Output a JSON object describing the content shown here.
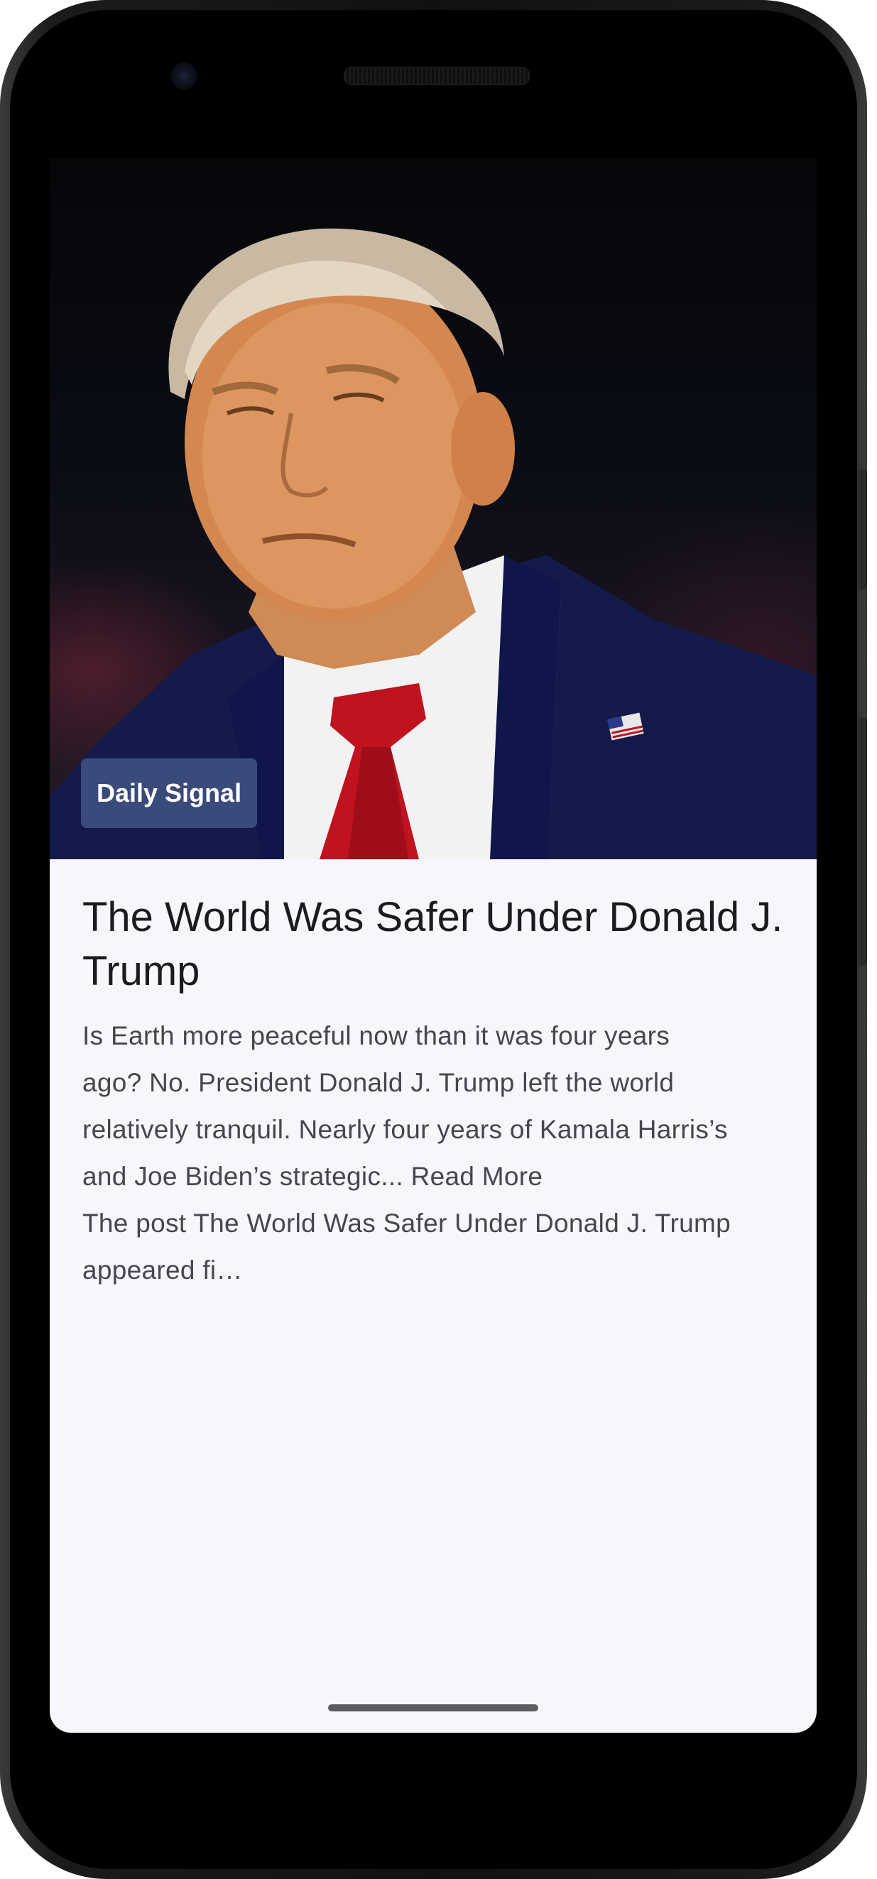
{
  "article": {
    "source": "Daily Signal",
    "title": "The World Was Safer Under Donald J. Trump",
    "summary_lines": [
      "Is Earth more peaceful now than it was four years",
      "ago? No. President Donald J. Trump left the world",
      "relatively tranquil. Nearly four years of Kamala Harris’s",
      "and Joe Biden’s strategic... Read More",
      "The post The World Was Safer Under Donald J. Trump",
      "appeared fi…"
    ]
  },
  "icons": {
    "camera": "front-camera-icon",
    "speaker": "earpiece-speaker-icon"
  },
  "colors": {
    "badge_background": "#3a4a7a",
    "screen_background": "#f7f6fc",
    "title_text": "#1b1b1f",
    "summary_text": "#45464f"
  }
}
